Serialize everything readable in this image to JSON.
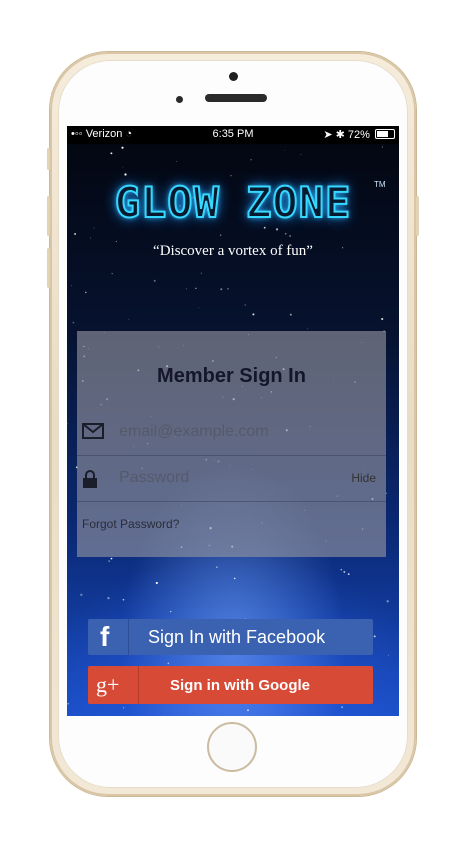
{
  "status_bar": {
    "carrier": "•◦◦ Verizon",
    "time": "6:35 PM",
    "battery": "72%"
  },
  "app": {
    "logo": "GLOW ZONE",
    "trademark": "TM",
    "tagline": "“Discover a vortex of fun”"
  },
  "sign_in": {
    "title": "Member Sign In",
    "email_placeholder": "email@example.com",
    "password_placeholder": "Password",
    "hide_label": "Hide",
    "forgot_label": "Forgot Password?"
  },
  "social": {
    "facebook_icon": "f",
    "facebook_label": "Sign In with Facebook",
    "google_icon": "g+",
    "google_label": "Sign in with Google"
  },
  "colors": {
    "facebook": "#3a62b1",
    "google": "#d74b36",
    "logo_glow": "#36d8ff"
  }
}
